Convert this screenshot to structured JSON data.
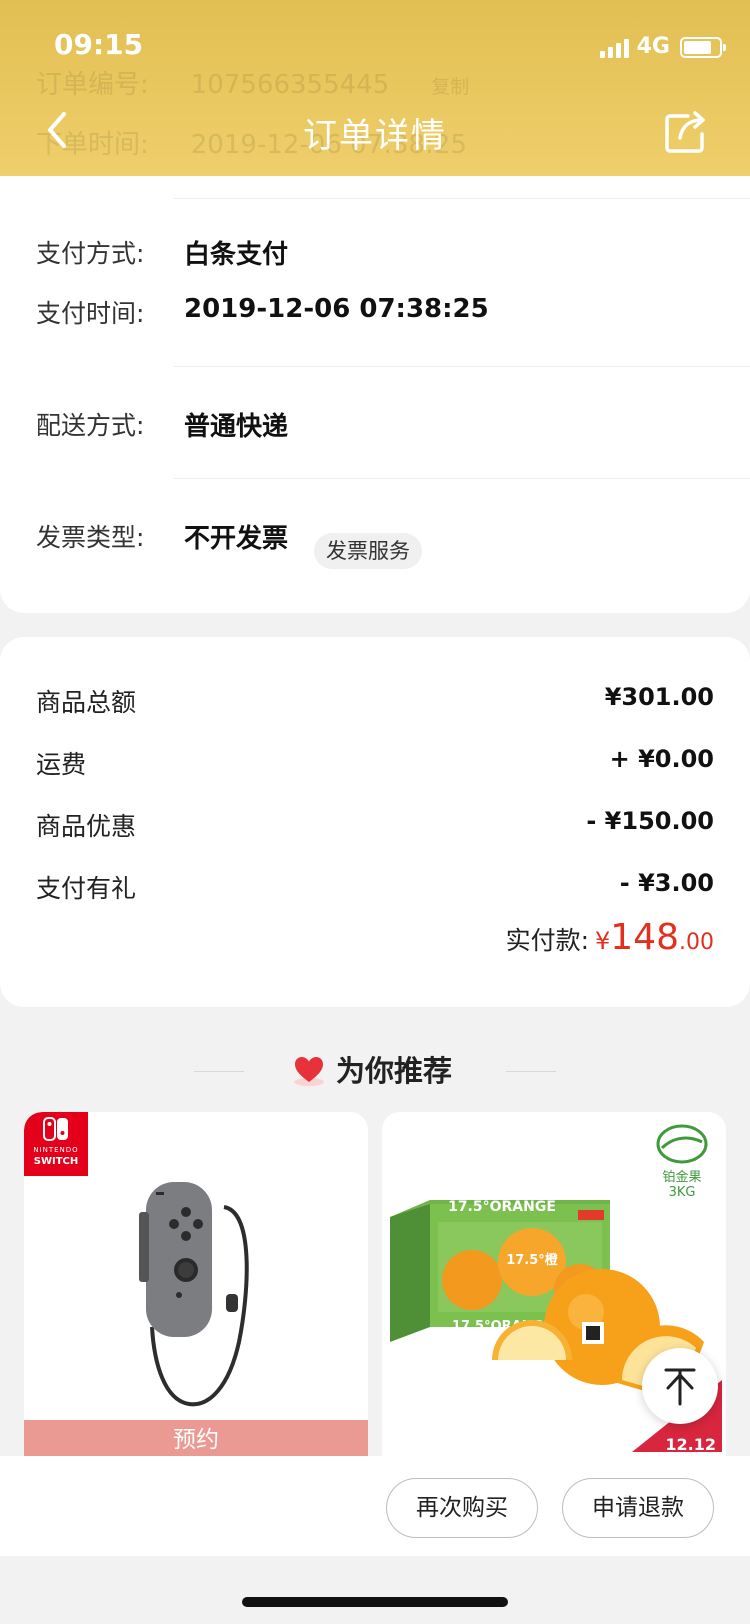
{
  "status_bar": {
    "time": "09:15",
    "network": "4G"
  },
  "header": {
    "title": "订单详情",
    "ghost_order_label": "订单编号:",
    "ghost_order_value": "107566355445",
    "ghost_copy": "复制",
    "ghost_time_label": "下单时间:",
    "ghost_time_value": "2019-12-06 07:38:25"
  },
  "order_info": {
    "payment_method_label": "支付方式:",
    "payment_method_value": "白条支付",
    "payment_time_label": "支付时间:",
    "payment_time_value": "2019-12-06 07:38:25",
    "delivery_label": "配送方式:",
    "delivery_value": "普通快递",
    "invoice_label": "发票类型:",
    "invoice_value": "不开发票",
    "invoice_service": "发票服务"
  },
  "amounts": {
    "rows": [
      {
        "label": "商品总额",
        "value": "¥301.00"
      },
      {
        "label": "运费",
        "value": "+ ¥0.00"
      },
      {
        "label": "商品优惠",
        "value": "- ¥150.00"
      },
      {
        "label": "支付有礼",
        "value": "- ¥3.00"
      }
    ],
    "paid_label": "实付款:",
    "paid_symbol": "¥",
    "paid_integer": "148",
    "paid_decimal": ".00"
  },
  "recommend": {
    "title": "为你推荐",
    "products": [
      {
        "badge_mini": "NINTENDO",
        "badge_brand": "SWITCH",
        "tag": "预约"
      },
      {
        "grade_line1": "铂金果",
        "grade_line2": "3KG",
        "box_text": "17.5°ORANGE",
        "box_label": "17.5°橙",
        "sale_tag": "12.12"
      }
    ]
  },
  "actions": {
    "rebuy": "再次购买",
    "refund": "申请退款"
  },
  "colors": {
    "header": "#e2bf52",
    "price_red": "#e3301e",
    "preorder": "#ea9a92"
  }
}
